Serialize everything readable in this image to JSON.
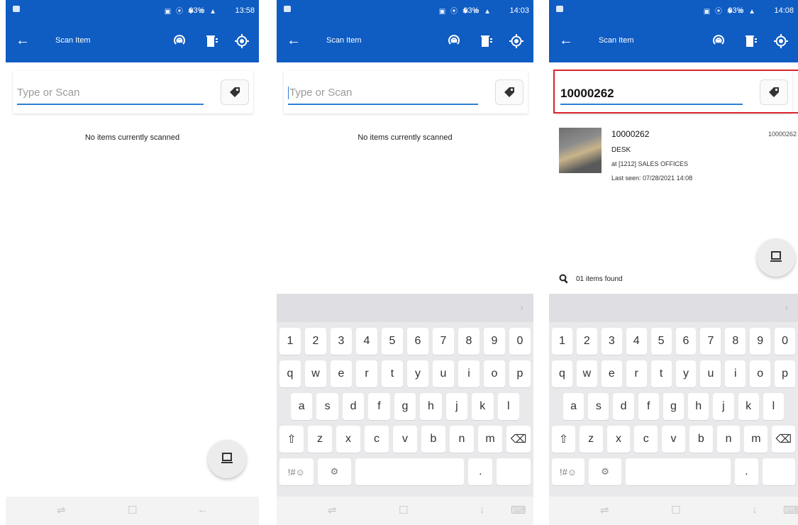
{
  "colors": {
    "brand": "#0f5cc2",
    "field_underline": "#2f7fd6",
    "highlight": "#d9232e"
  },
  "screens": [
    {
      "status": {
        "time": "13:58",
        "battery": "93%"
      },
      "appbar": {
        "title": "Scan Item"
      },
      "search": {
        "placeholder": "Type or Scan"
      },
      "empty_text": "No items currently scanned"
    },
    {
      "status": {
        "time": "14:03",
        "battery": "93%"
      },
      "appbar": {
        "title": "Scan Item"
      },
      "search": {
        "placeholder": "Type or Scan"
      },
      "empty_text": "No items currently scanned"
    },
    {
      "status": {
        "time": "14:08",
        "battery": "93%"
      },
      "appbar": {
        "title": "Scan Item"
      },
      "search": {
        "value": "10000262"
      },
      "result": {
        "id": "10000262",
        "right_id": "10000262",
        "name": "DESK",
        "location": "at [1212] SALES OFFICES",
        "last_seen": "Last seen: 07/28/2021 14:08"
      },
      "found_text": "01 items found"
    }
  ],
  "keyboard": {
    "rows": [
      [
        "1",
        "2",
        "3",
        "4",
        "5",
        "6",
        "7",
        "8",
        "9",
        "0"
      ],
      [
        "q",
        "w",
        "e",
        "r",
        "t",
        "y",
        "u",
        "i",
        "o",
        "p"
      ],
      [
        "a",
        "s",
        "d",
        "f",
        "g",
        "h",
        "j",
        "k",
        "l"
      ],
      [
        "⇧",
        "z",
        "x",
        "c",
        "v",
        "b",
        "n",
        "m",
        "⌫"
      ]
    ],
    "symbols_label": "!#☺"
  },
  "icons": [
    "back-arrow-icon",
    "nfc-icon",
    "trash-icon",
    "target-icon",
    "tag-icon",
    "scanner-icon",
    "search-icon"
  ]
}
